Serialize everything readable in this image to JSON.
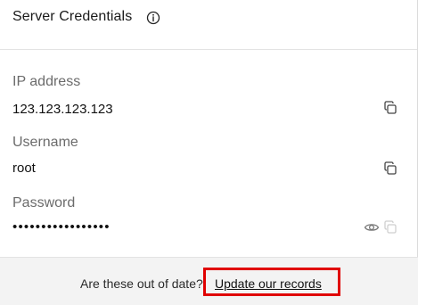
{
  "header": {
    "title": "Server Credentials",
    "info_icon": "info-icon"
  },
  "fields": [
    {
      "label": "IP address",
      "value": "123.123.123.123",
      "actions": [
        "copy-icon"
      ]
    },
    {
      "label": "Username",
      "value": "root",
      "actions": [
        "copy-icon"
      ]
    },
    {
      "label": "Password",
      "value": "•••••••••••••••••",
      "actions": [
        "eye-icon",
        "copy-icon"
      ],
      "copy_disabled": true
    }
  ],
  "footer": {
    "prompt": "Are these out of date?",
    "link_label": "Update our records"
  },
  "colors": {
    "highlight": "#e00000",
    "footer_bg": "#f3f3f3",
    "label": "#6b6b6b"
  }
}
